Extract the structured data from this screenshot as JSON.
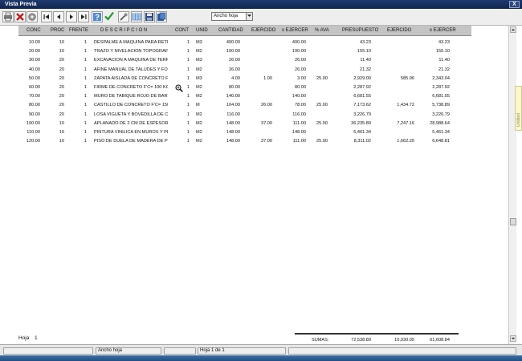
{
  "window": {
    "title": "Vista Previa",
    "close_label": "X"
  },
  "toolbar": {
    "zoom_value": "Ancho hoja",
    "buttons": [
      "printer-icon",
      "close-x-icon",
      "page-setup-icon",
      "first-page-icon",
      "previous-page-icon",
      "next-page-icon",
      "last-page-icon",
      "help-icon",
      "check-icon",
      "tools-icon",
      "grid-icon",
      "save-icon",
      "export-icon"
    ],
    "accent_check": "#1e9a2a",
    "accent_close": "#c0191b"
  },
  "table": {
    "headers": [
      "CONC",
      "PROC",
      "FRENTE",
      "D E S C R I P C I O N",
      "CONT",
      "UNID",
      "CANTIDAD",
      "EJERCIDO",
      "x EJERCER",
      "% AVA",
      "PRESUPUESTO",
      "EJERCIDO",
      "x EJERCER"
    ],
    "rows": [
      [
        "10.00",
        "10",
        "1",
        "DESPALME A MAQUINA PARA RETI",
        "1",
        "M3",
        "400.00",
        "",
        "400.00",
        "",
        "43.23",
        "",
        "43.23"
      ],
      [
        "20.00",
        "10",
        "1",
        "TRAZO Y NIVELACION TOPOGRAFIC",
        "1",
        "M2",
        "100.00",
        "",
        "100.00",
        "",
        "155.10",
        "",
        "155.10"
      ],
      [
        "30.00",
        "20",
        "1",
        "EXCAVACION A MAQUINA DE TERR",
        "1",
        "M3",
        "26.00",
        "",
        "26.00",
        "",
        "11.40",
        "",
        "11.40"
      ],
      [
        "40.00",
        "20",
        "1",
        "AFINE MANUAL DE TALUDES Y FON",
        "1",
        "M2",
        "26.00",
        "",
        "26.00",
        "",
        "21.32",
        "",
        "21.32"
      ],
      [
        "50.00",
        "20",
        "1",
        "ZAPATA AISLADA DE CONCRETO F'",
        "1",
        "M3",
        "4.00",
        "1.00",
        "3.00",
        "25.00",
        "2,929.00",
        "585.96",
        "2,343.04"
      ],
      [
        "60.00",
        "20",
        "1",
        "FIRME DE CONCRETO F'C= 100 KG/",
        "1",
        "M2",
        "80.00",
        "",
        "80.00",
        "",
        "2,287.92",
        "",
        "2,287.92"
      ],
      [
        "70.00",
        "20",
        "1",
        "MURO DE TABIQUE ROJO DE BARR",
        "1",
        "M2",
        "140.00",
        "",
        "140.00",
        "",
        "6,681.55",
        "",
        "6,681.55"
      ],
      [
        "80.00",
        "20",
        "1",
        "CASTILLO DE CONCRETO F'C= 150",
        "1",
        "M",
        "104.00",
        "26.00",
        "78.00",
        "25.00",
        "7,173.62",
        "1,434.72",
        "5,738.89"
      ],
      [
        "90.00",
        "20",
        "1",
        "LOSA VIGUETA Y BOVEDILLA DE CC",
        "1",
        "M2",
        "116.00",
        "",
        "116.00",
        "",
        "3,226.79",
        "",
        "3,226.79"
      ],
      [
        "100.00",
        "10",
        "1",
        "APLANADO DE 2 CM DE ESPESOR I",
        "1",
        "M2",
        "148.00",
        "37.00",
        "111.00",
        "25.00",
        "36,235.80",
        "7,247.16",
        "28,988.64"
      ],
      [
        "110.00",
        "10",
        "1",
        "PINTURA VINILICA EN MUROS Y PL",
        "1",
        "M2",
        "148.00",
        "",
        "148.00",
        "",
        "5,461.34",
        "",
        "5,461.34"
      ],
      [
        "120.00",
        "10",
        "1",
        "PISO DE DUELA DE MADERA DE PII",
        "1",
        "M2",
        "148.00",
        "37.00",
        "111.00",
        "25.00",
        "8,311.02",
        "1,662.20",
        "6,648.81"
      ]
    ]
  },
  "footer": {
    "page_label": "Hoja",
    "page_number": "1",
    "sums_label": "SUMAS:",
    "sum_presupuesto": "72,538.89",
    "sum_ejercido": "10,930.05",
    "sum_x_ejercer": "61,608.84"
  },
  "side_tab_label": "Untitled",
  "statusbar": {
    "zoom": "Ancho hoja",
    "page_info": "Hoja 1 de 1"
  }
}
